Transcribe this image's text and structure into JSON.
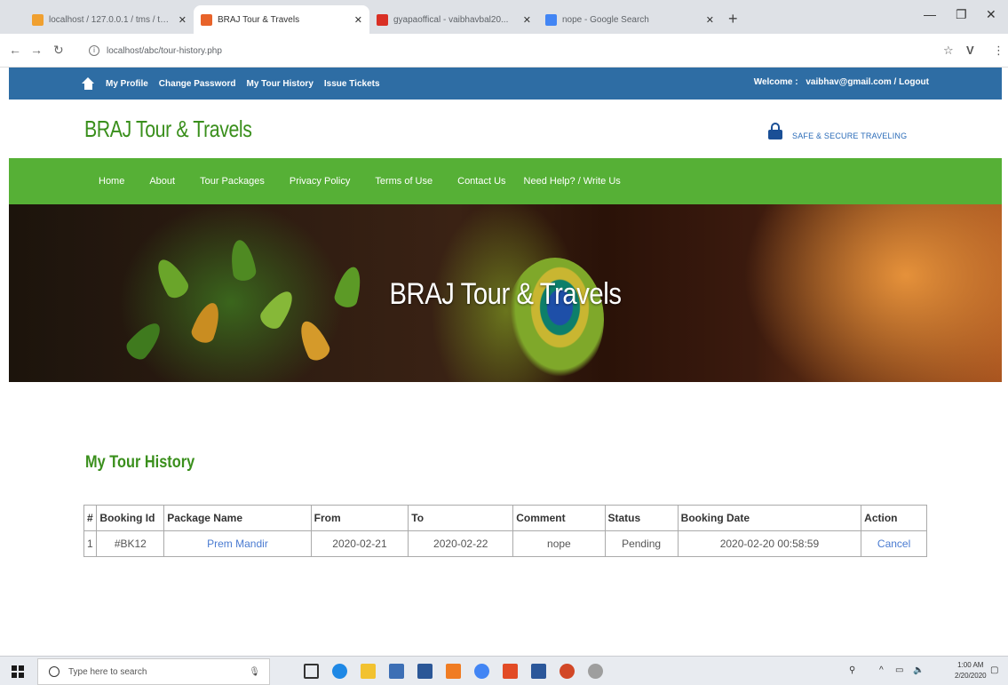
{
  "browser": {
    "tabs": [
      {
        "label": "localhost / 127.0.0.1 / tms / tbl...",
        "active": false,
        "favicon_color": "#f0a030"
      },
      {
        "label": "BRAJ Tour & Travels",
        "active": true,
        "favicon_color": "#e8632a"
      },
      {
        "label": "gyapaoffical - vaibhavbal20...",
        "active": false,
        "favicon_color": "#d93025"
      },
      {
        "label": "nope - Google Search",
        "active": false,
        "favicon_color": "#4285f4"
      }
    ],
    "url": "localhost/abc/tour-history.php"
  },
  "topbar": {
    "links": [
      "My Profile",
      "Change Password",
      "My Tour History",
      "Issue Tickets"
    ],
    "welcome_label": "Welcome :",
    "user_email_logout": "vaibhav@gmail.com / Logout"
  },
  "header": {
    "brand": "BRAJ Tour & Travels",
    "secure_text": "SAFE & SECURE TRAVELING"
  },
  "nav": {
    "items": [
      "Home",
      "About",
      "Tour Packages",
      "Privacy Policy",
      "Terms of Use",
      "Contact Us",
      "Need Help? / Write Us"
    ]
  },
  "banner": {
    "title": "BRAJ Tour & Travels"
  },
  "main": {
    "section_title": "My Tour History",
    "table": {
      "headers": [
        "#",
        "Booking Id",
        "Package Name",
        "From",
        "To",
        "Comment",
        "Status",
        "Booking Date",
        "Action"
      ],
      "rows": [
        [
          "1",
          "#BK12",
          "Prem Mandir",
          "2020-02-21",
          "2020-02-22",
          "nope",
          "Pending",
          "2020-02-20 00:58:59",
          "Cancel"
        ]
      ]
    }
  },
  "taskbar": {
    "search_placeholder": "Type here to search",
    "time": "1:00 AM",
    "date": "2/20/2020"
  }
}
